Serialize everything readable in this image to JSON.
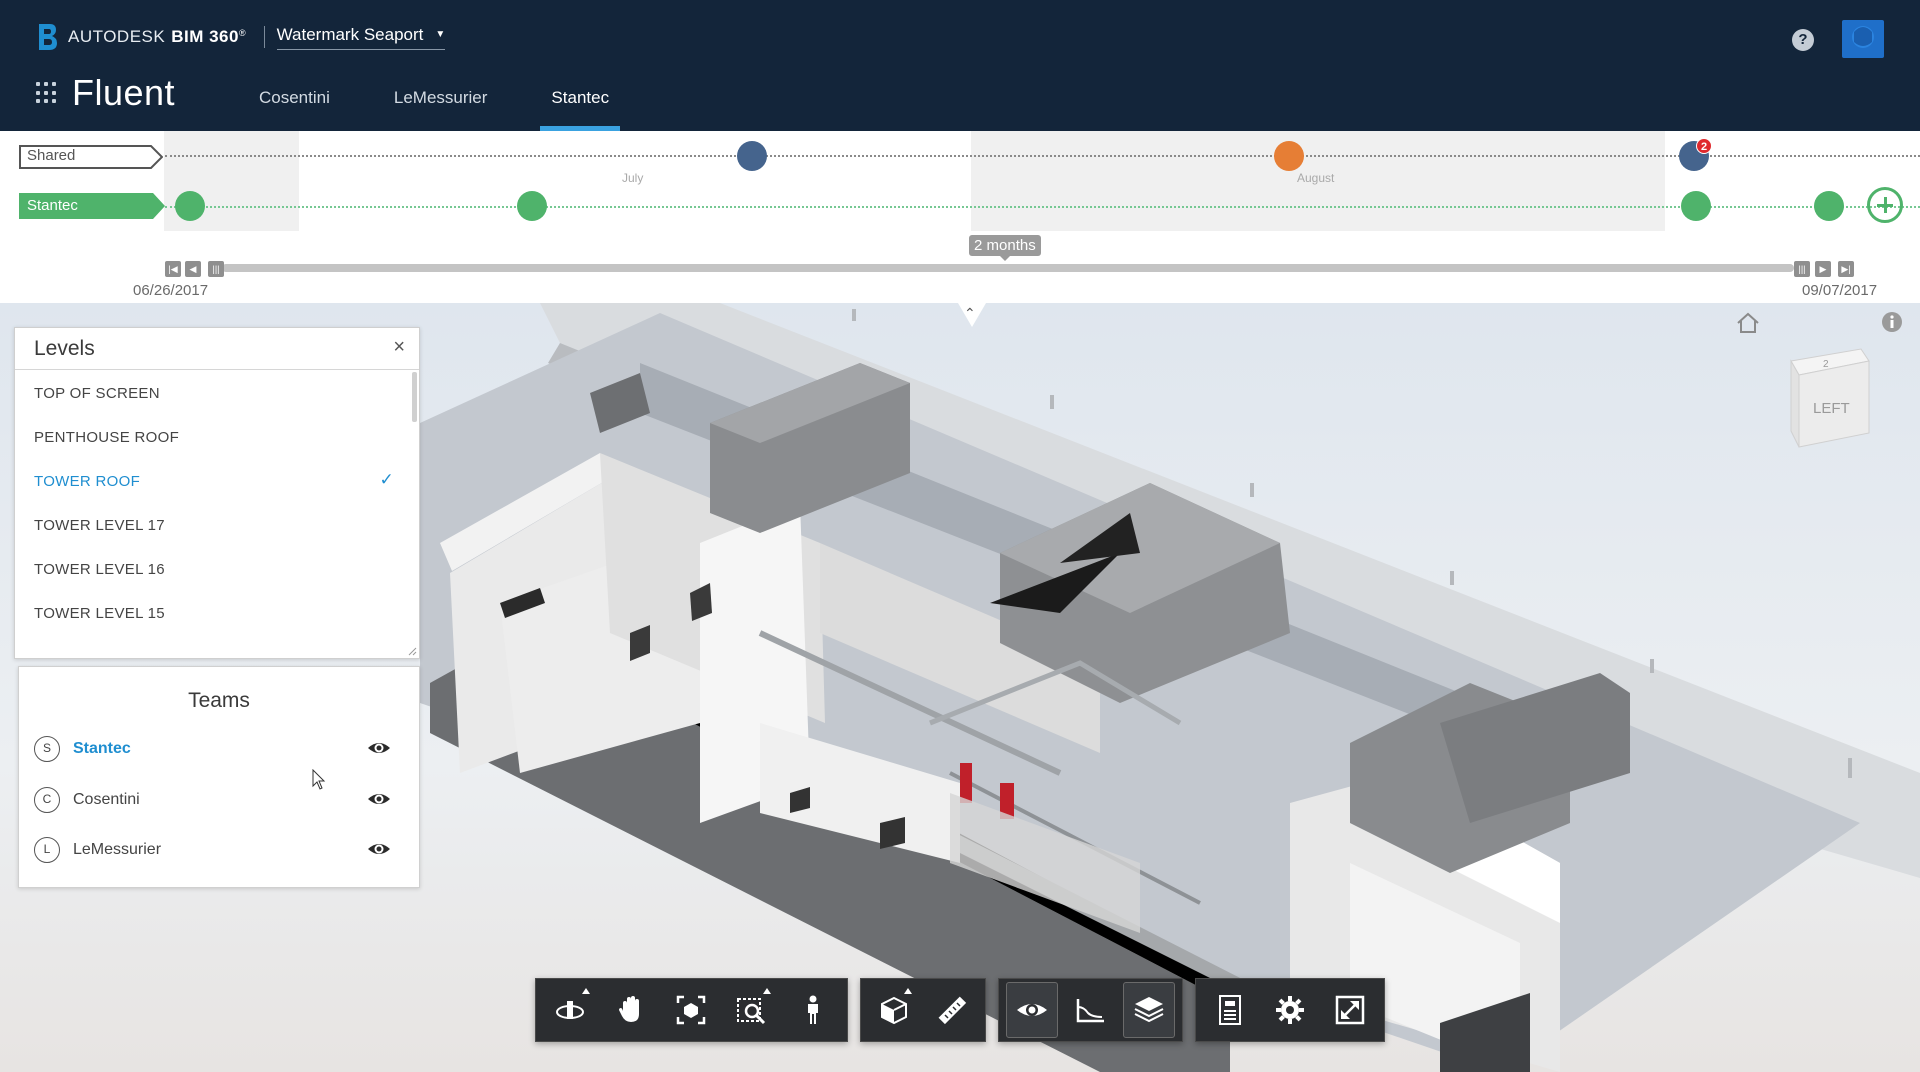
{
  "header": {
    "brand_prefix": "AUTODESK",
    "brand_product": "BIM 360",
    "brand_mark": "®",
    "project": "Watermark Seaport",
    "app_title": "Fluent",
    "tabs": [
      {
        "label": "Cosentini",
        "active": false
      },
      {
        "label": "LeMessurier",
        "active": false
      },
      {
        "label": "Stantec",
        "active": true
      }
    ],
    "help_glyph": "?"
  },
  "timeline": {
    "tracks": [
      {
        "label": "Shared",
        "style": "outline"
      },
      {
        "label": "Stantec",
        "style": "filled",
        "color": "#4fb36b"
      }
    ],
    "months": [
      "July",
      "August"
    ],
    "notification_count": "2",
    "range_label": "2 months",
    "start_date": "06/26/2017",
    "end_date": "09/07/2017"
  },
  "levels": {
    "title": "Levels",
    "close_glyph": "×",
    "items": [
      {
        "label": "TOP OF SCREEN",
        "selected": false
      },
      {
        "label": "PENTHOUSE ROOF",
        "selected": false
      },
      {
        "label": "TOWER ROOF",
        "selected": true
      },
      {
        "label": "TOWER LEVEL 17",
        "selected": false
      },
      {
        "label": "TOWER LEVEL 16",
        "selected": false
      },
      {
        "label": "TOWER LEVEL 15",
        "selected": false
      }
    ],
    "check_glyph": "✓"
  },
  "teams": {
    "title": "Teams",
    "items": [
      {
        "initial": "S",
        "name": "Stantec",
        "active": true
      },
      {
        "initial": "C",
        "name": "Cosentini",
        "active": false
      },
      {
        "initial": "L",
        "name": "LeMessurier",
        "active": false
      }
    ]
  },
  "viewcube": {
    "face": "LEFT"
  },
  "toolbar": {
    "groups": [
      [
        "orbit-icon",
        "pan-icon",
        "fit-to-view-icon",
        "zoom-window-icon",
        "first-person-icon"
      ],
      [
        "section-box-icon",
        "measure-icon"
      ],
      [
        "visibility-icon",
        "profile-icon",
        "layers-icon"
      ],
      [
        "properties-icon",
        "settings-icon",
        "fullscreen-icon"
      ]
    ]
  },
  "colors": {
    "nav_bg": "#13253a",
    "accent_blue": "#1f8ed0",
    "tab_underline": "#3aa2e0",
    "team_green": "#4fb36b",
    "shared_blue": "#45648d",
    "shared_orange": "#e67e35",
    "notification_red": "#e0292d"
  }
}
